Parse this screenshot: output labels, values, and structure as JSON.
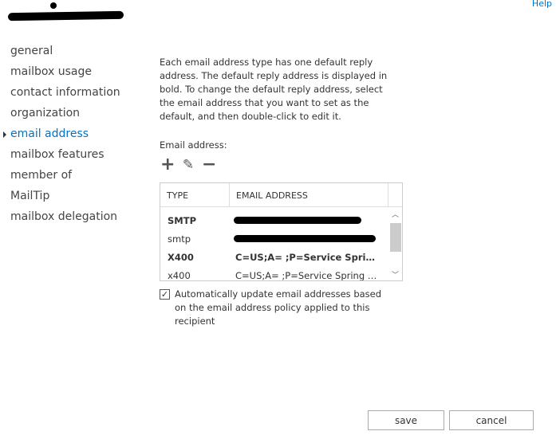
{
  "header": {
    "help_label": "Help"
  },
  "nav": {
    "items": [
      "general",
      "mailbox usage",
      "contact information",
      "organization",
      "email address",
      "mailbox features",
      "member of",
      "MailTip",
      "mailbox delegation"
    ],
    "selected_index": 4
  },
  "main": {
    "description": "Each email address type has one default reply address. The default reply address is displayed in bold. To change the default reply address, select the email address that you want to set as the default, and then double-click to edit it.",
    "email_label": "Email address:",
    "tools": {
      "add": "+",
      "edit": "✎",
      "remove": "−"
    },
    "table": {
      "headers": [
        "TYPE",
        "EMAIL ADDRESS"
      ],
      "rows": [
        {
          "type": "SMTP",
          "address": "",
          "bold": true
        },
        {
          "type": "smtp",
          "address": "",
          "bold": false
        },
        {
          "type": "X400",
          "address": "C=US;A= ;P=Service Spring C;O...",
          "bold": true
        },
        {
          "type": "x400",
          "address": "C=US;A= ;P=Service Spring C;O=...",
          "bold": false
        }
      ]
    },
    "auto_update": {
      "checked": true,
      "label": "Automatically update email addresses based on the email address policy applied to this recipient"
    }
  },
  "footer": {
    "save": "save",
    "cancel": "cancel"
  }
}
